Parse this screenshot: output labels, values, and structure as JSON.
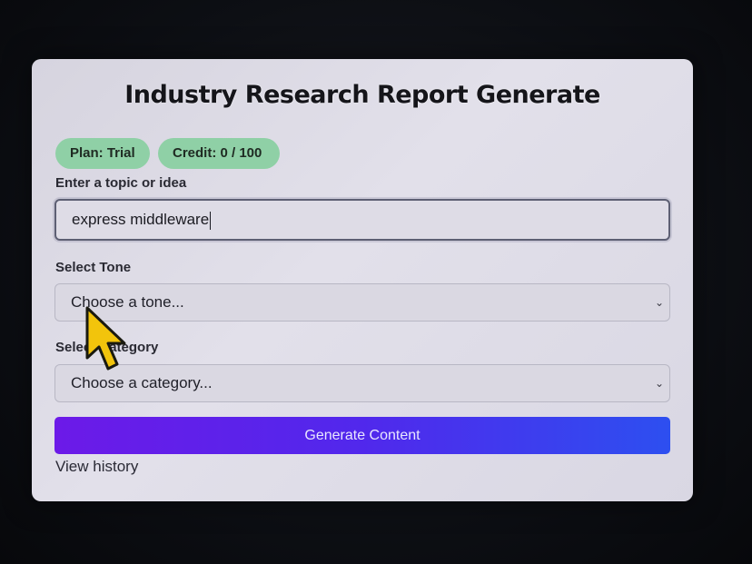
{
  "app": {
    "title": "Industry Research Report Generate"
  },
  "badges": {
    "plan": "Plan: Trial",
    "credit": "Credit: 0 / 100"
  },
  "topic": {
    "label": "Enter a topic or idea",
    "value": "express middleware"
  },
  "tone": {
    "label": "Select Tone",
    "selected": "Choose a tone..."
  },
  "category": {
    "label": "Select Category",
    "selected": "Choose a category..."
  },
  "actions": {
    "generate_label": "Generate Content",
    "history_label": "View history"
  },
  "colors": {
    "badge": "#8fd0a6",
    "button_start": "#6c1ae8",
    "button_end": "#2d4ff0",
    "cursor": "#f2c40c"
  },
  "icons": {
    "select_arrow": "chevron-down-icon",
    "pointer": "mouse-cursor-icon"
  }
}
